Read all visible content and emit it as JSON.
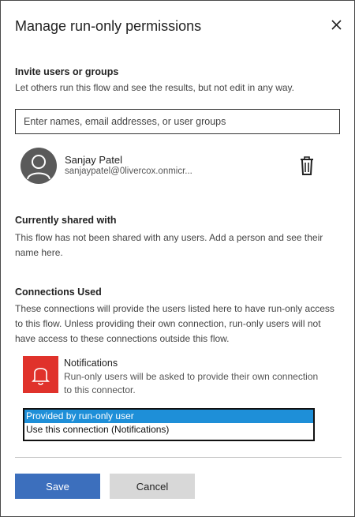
{
  "dialog": {
    "title": "Manage run-only permissions",
    "close_icon": "close-icon"
  },
  "invite": {
    "heading": "Invite users or groups",
    "description": "Let others run this flow and see the results, but not edit in any way.",
    "placeholder": "Enter names, email addresses, or user groups"
  },
  "user": {
    "name": "Sanjay Patel",
    "email": "sanjaypatel@0livercox.onmicr...",
    "avatar_icon": "person-icon",
    "delete_icon": "trash-icon"
  },
  "shared": {
    "heading": "Currently shared with",
    "description": "This flow has not been shared with any users. Add a person and see their name here."
  },
  "connections": {
    "heading": "Connections Used",
    "description": "These connections will provide the users listed here to have run-only access to this flow. Unless providing their own connection, run-only users will not have access to these connections outside this flow.",
    "items": [
      {
        "name": "Notifications",
        "description": "Run-only users will be asked to provide their own connection to this connector.",
        "icon": "bell-icon",
        "icon_color": "#e0322b",
        "options": [
          "Provided by run-only user",
          "Use this connection (Notifications)"
        ],
        "selected": "Provided by run-only user"
      }
    ]
  },
  "footer": {
    "save_label": "Save",
    "cancel_label": "Cancel"
  },
  "colors": {
    "primary": "#3c6fbd",
    "selection": "#1e8fd8",
    "secondary_button": "#d8d8d8"
  }
}
